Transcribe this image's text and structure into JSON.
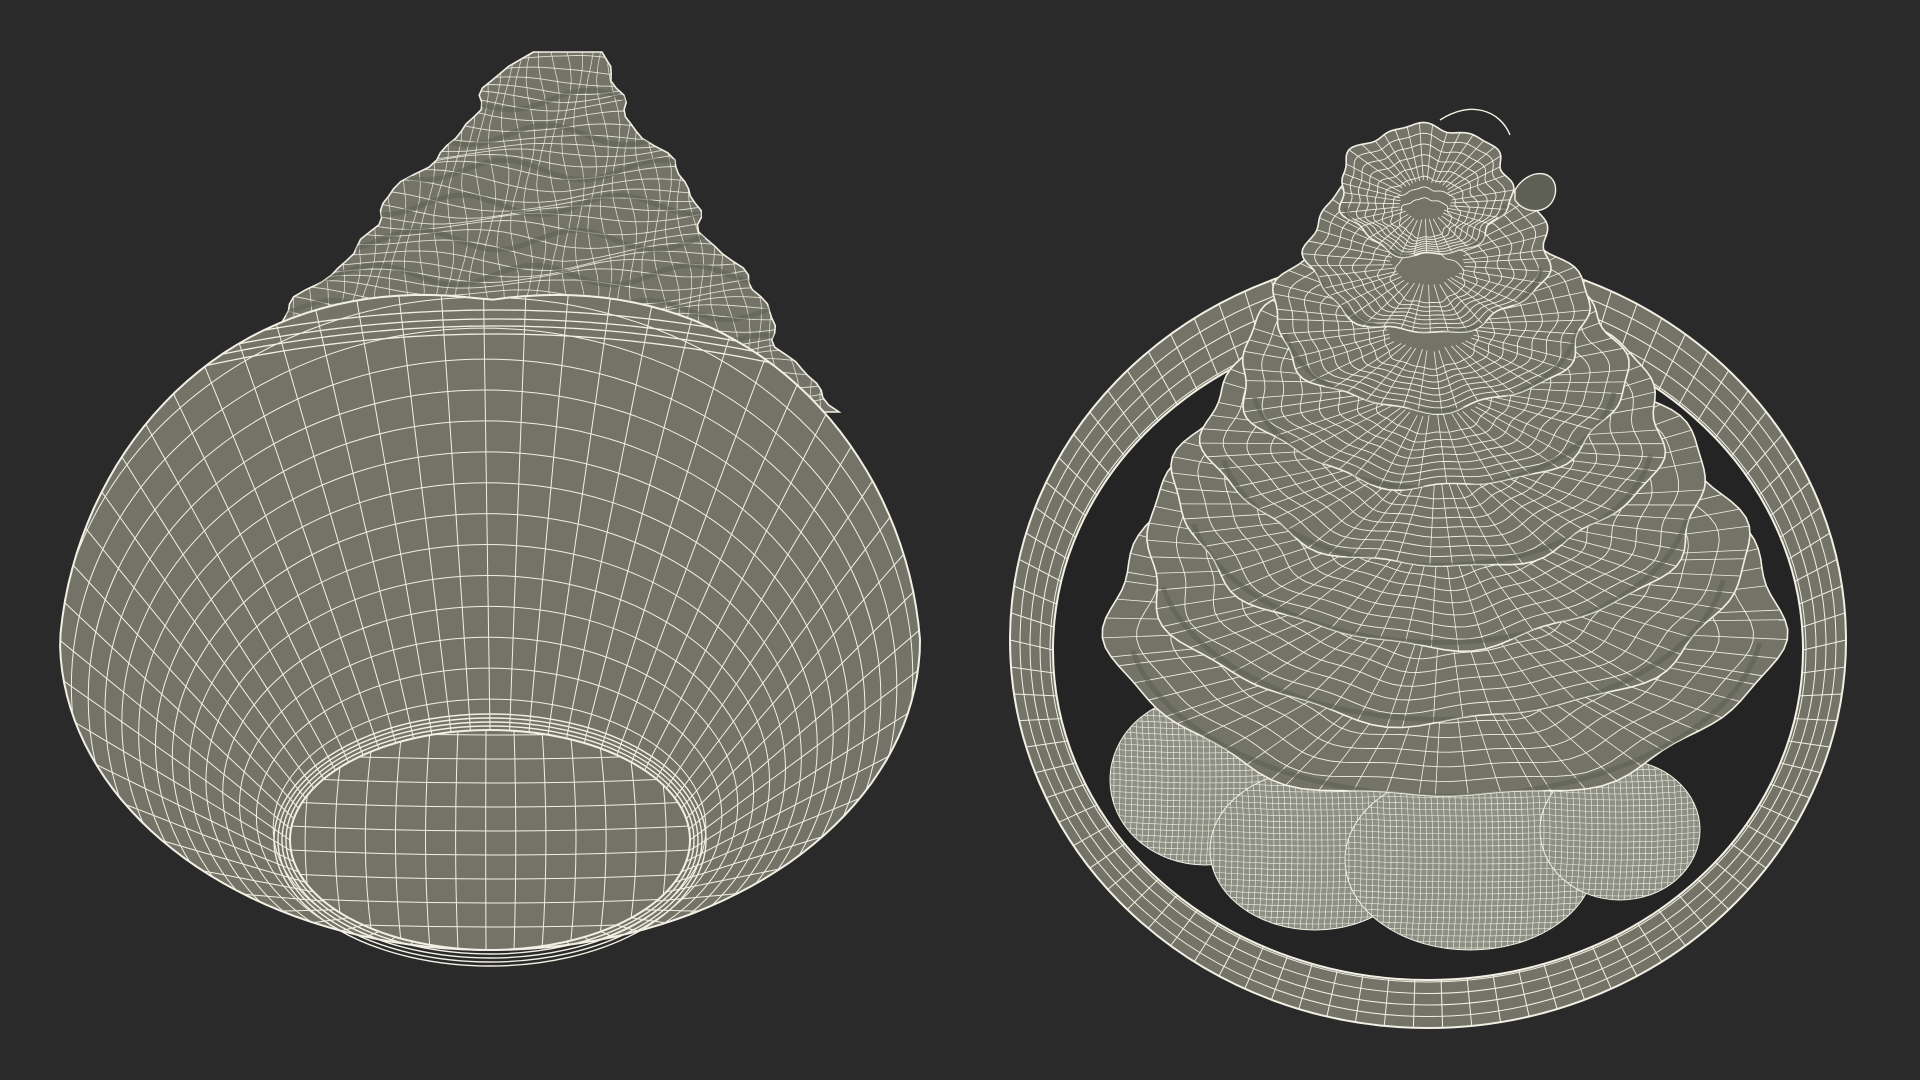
{
  "scene": {
    "background": "#2a2a2a",
    "mesh_fill": "#737467",
    "mesh_fill_dark": "#5f6055",
    "wire_color": "#f2f0e4",
    "views": [
      {
        "name": "bottom-view",
        "object": "cupcake-wireframe-bottom"
      },
      {
        "name": "top-view",
        "object": "cupcake-wireframe-top"
      }
    ]
  }
}
